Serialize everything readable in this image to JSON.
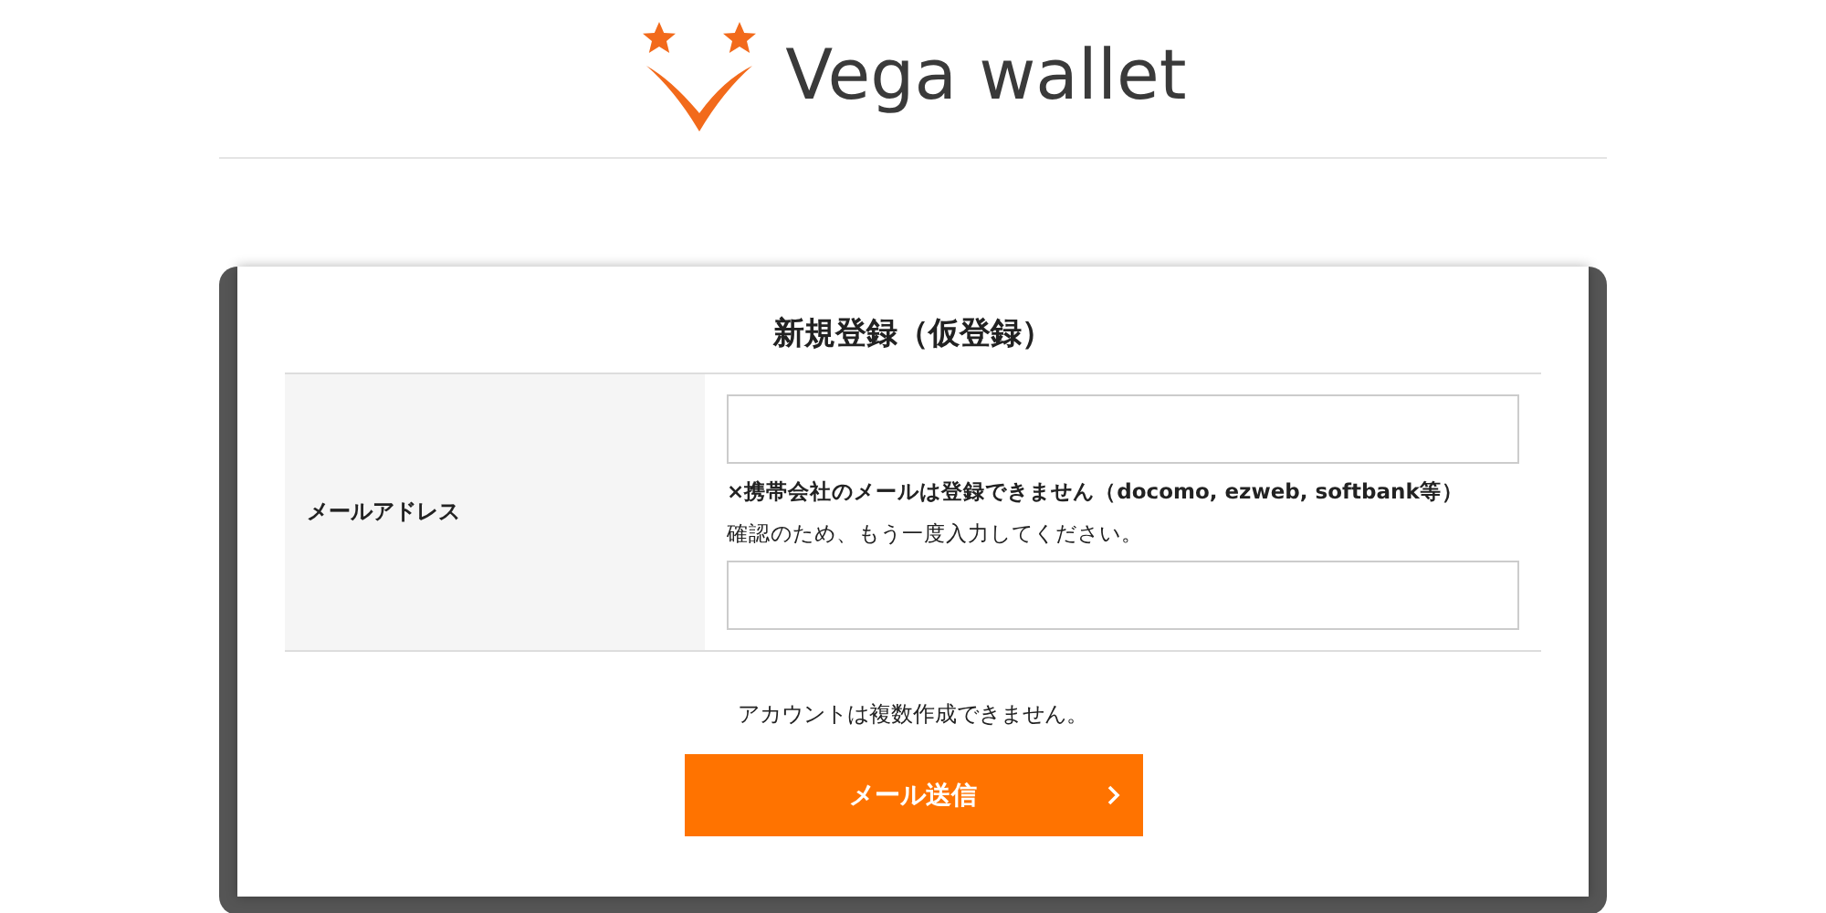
{
  "header": {
    "logo_text": "Vega wallet"
  },
  "form": {
    "title": "新規登録（仮登録）",
    "field_label": "メールアドレス",
    "note": "×携帯会社のメールは登録できません（docomo, ezweb, softbank等）",
    "confirm_hint": "確認のため、もう一度入力してください。",
    "notice": "アカウントは複数作成できません。",
    "submit": "メール送信"
  }
}
